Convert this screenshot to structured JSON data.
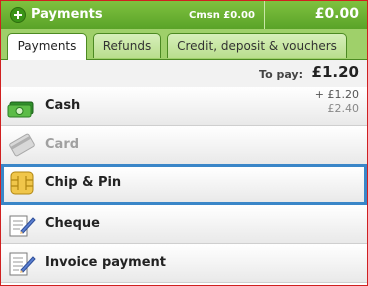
{
  "header": {
    "title": "Payments",
    "commission": "Cmsn £0.00",
    "total": "£0.00"
  },
  "tabs": [
    {
      "label": "Payments",
      "active": true
    },
    {
      "label": "Refunds",
      "active": false
    },
    {
      "label": "Credit, deposit & vouchers",
      "active": false
    }
  ],
  "to_pay": {
    "label": "To pay:",
    "value": "£1.20"
  },
  "methods": [
    {
      "label": "Cash",
      "icon": "cash-icon",
      "enabled": true,
      "amount_added": "+ £1.20",
      "amount_prev": "£2.40"
    },
    {
      "label": "Card",
      "icon": "card-icon",
      "enabled": false
    },
    {
      "label": "Chip & Pin",
      "icon": "chip-icon",
      "enabled": true,
      "selected": true
    },
    {
      "label": "Cheque",
      "icon": "cheque-icon",
      "enabled": true
    },
    {
      "label": "Invoice payment",
      "icon": "invoice-icon",
      "enabled": true
    }
  ],
  "colors": {
    "header_green": "#5aa328",
    "selection_blue": "#3a86c8",
    "frame_red": "#d02020"
  }
}
